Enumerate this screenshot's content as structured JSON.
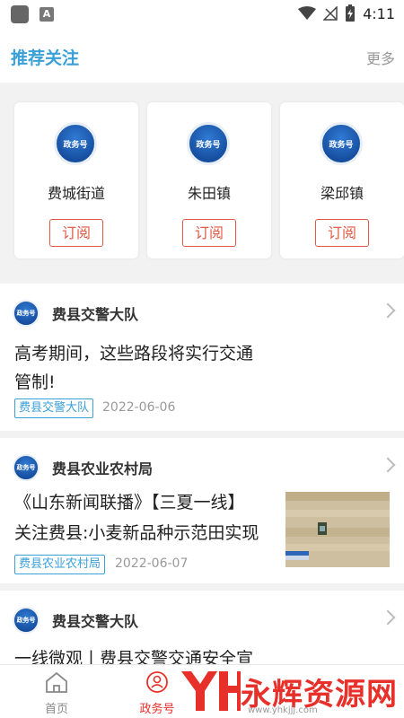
{
  "status_bar": {
    "time": "4:11",
    "notification_icon": "A"
  },
  "header": {
    "title": "推荐关注",
    "more": "更多"
  },
  "cards": [
    {
      "name": "费城街道",
      "logo_text": "政务号",
      "button": "订阅"
    },
    {
      "name": "朱田镇",
      "logo_text": "政务号",
      "button": "订阅"
    },
    {
      "name": "梁邱镇",
      "logo_text": "政务号",
      "button": "订阅"
    }
  ],
  "feed": [
    {
      "source": "费县交警大队",
      "logo_text": "政务号",
      "title_line1": "高考期间，这些路段将实行交通",
      "title_line2": "管制!",
      "tag": "费县交警大队",
      "date": "2022-06-06"
    },
    {
      "source": "费县农业农村局",
      "logo_text": "政务号",
      "title_line1": "《山东新闻联播》【三夏一线】",
      "title_line2": "关注费县:小麦新品种示范田实现",
      "tag": "费县农业农村局",
      "date": "2022-06-07"
    },
    {
      "source": "费县交警大队",
      "logo_text": "政务号",
      "title_line1": "一线微观丨费县交警交通安全宣"
    }
  ],
  "bottom_nav": [
    {
      "label": "首页",
      "icon": "home-icon",
      "active": false
    },
    {
      "label": "政务号",
      "icon": "gov-account-icon",
      "active": true
    }
  ],
  "watermark": {
    "text": "永辉资源网",
    "url": "www.yhkjjj.com"
  },
  "colors": {
    "accent": "#3aa0d8",
    "button_red": "#e05a45",
    "active_nav": "#e7302a"
  }
}
